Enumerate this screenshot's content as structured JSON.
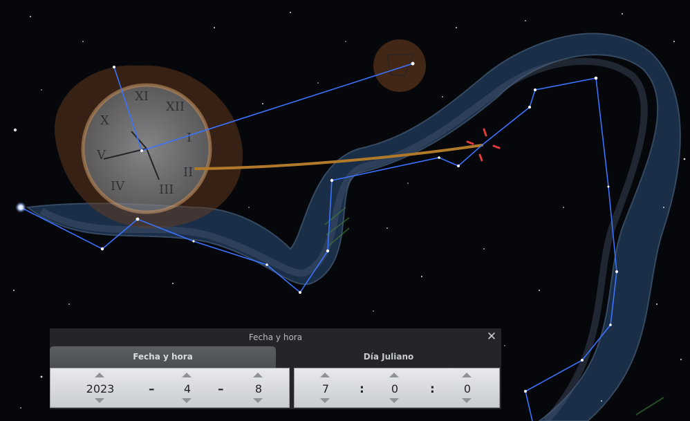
{
  "dialog": {
    "title": "Fecha y hora",
    "close_glyph": "✕",
    "tabs": [
      {
        "label": "Fecha y hora",
        "active": true
      },
      {
        "label": "Día Juliano",
        "active": false
      }
    ],
    "date": {
      "year": "2023",
      "month": "4",
      "day": "8",
      "separator": "–"
    },
    "time": {
      "hour": "7",
      "minute": "0",
      "second": "0",
      "separator": ":"
    }
  },
  "sky": {
    "constellation_line_color": "#3b73ff",
    "ecliptic_color": "#b07a2a",
    "marker_color": "#e23b3b",
    "art_color": "#9ab4d2",
    "clock_art_color": "#c9874a"
  },
  "icons": {
    "close": "close-icon",
    "spin_up": "chevron-up-icon",
    "spin_down": "chevron-down-icon"
  }
}
